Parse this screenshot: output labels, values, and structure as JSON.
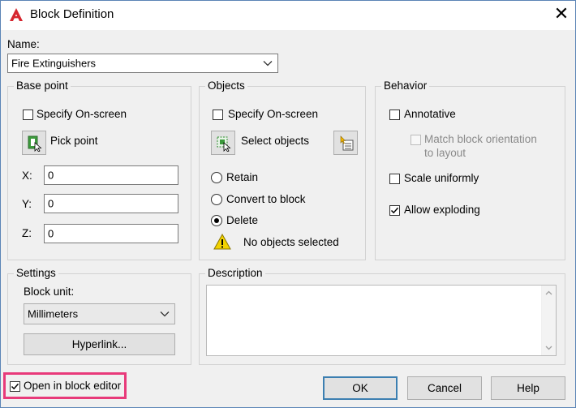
{
  "window": {
    "title": "Block Definition",
    "close_glyph": "✕"
  },
  "name_field": {
    "label": "Name:",
    "value": "Fire Extinguishers"
  },
  "base_point": {
    "title": "Base point",
    "specify_onscreen": {
      "label": "Specify On-screen",
      "checked": false
    },
    "pick_point_label": "Pick point",
    "x": {
      "label": "X:",
      "value": "0"
    },
    "y": {
      "label": "Y:",
      "value": "0"
    },
    "z": {
      "label": "Z:",
      "value": "0"
    }
  },
  "objects": {
    "title": "Objects",
    "specify_onscreen": {
      "label": "Specify On-screen",
      "checked": false
    },
    "select_objects_label": "Select objects",
    "retain_label": "Retain",
    "convert_label": "Convert to block",
    "delete_label": "Delete",
    "selected_option": "delete",
    "status_text": "No objects selected"
  },
  "behavior": {
    "title": "Behavior",
    "annotative": {
      "label": "Annotative",
      "checked": false
    },
    "match_orientation": {
      "label_line1": "Match block orientation",
      "label_line2": "to layout",
      "checked": false,
      "enabled": false
    },
    "scale_uniformly": {
      "label": "Scale uniformly",
      "checked": false
    },
    "allow_exploding": {
      "label": "Allow exploding",
      "checked": true
    }
  },
  "settings": {
    "title": "Settings",
    "block_unit_label": "Block unit:",
    "block_unit_value": "Millimeters",
    "hyperlink_label": "Hyperlink..."
  },
  "description": {
    "title": "Description",
    "value": ""
  },
  "open_in_editor": {
    "label": "Open in block editor",
    "checked": true
  },
  "buttons": {
    "ok": "OK",
    "cancel": "Cancel",
    "help": "Help"
  },
  "colors": {
    "accent": "#3c7fb1",
    "highlight": "#e83a7a",
    "app_icon": "#d6262f",
    "warning": "#f2d200"
  }
}
